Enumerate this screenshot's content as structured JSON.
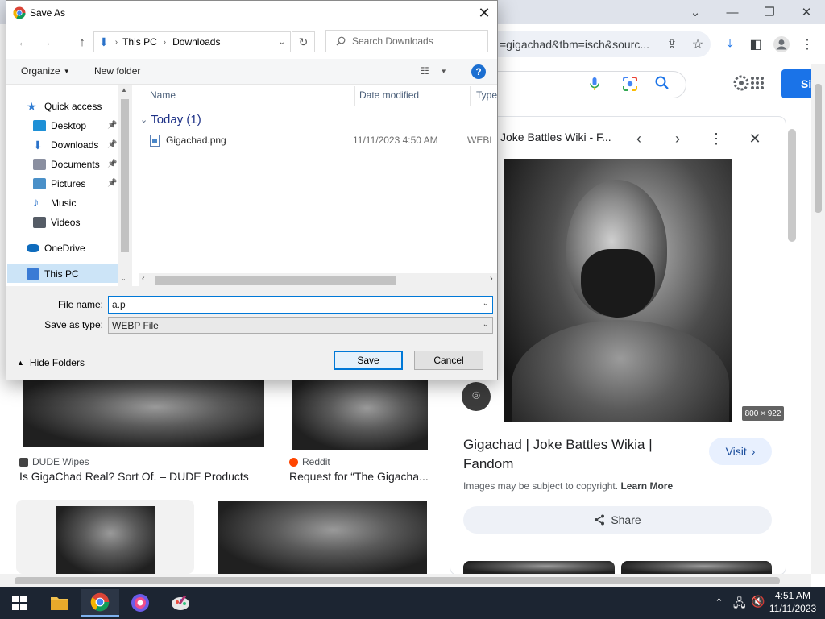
{
  "chrome": {
    "omnibox_text": "=gigachad&tbm=isch&sourc...",
    "window_controls": {
      "chevron_icon": "chevron-down-icon",
      "minimize_icon": "minimize-icon",
      "restore_icon": "restore-icon",
      "close_icon": "close-icon"
    }
  },
  "google": {
    "signin_label": "Si"
  },
  "results": [
    {
      "source": "DUDE Wipes",
      "title": "Is GigaChad Real? Sort Of. – DUDE Products",
      "favicon_color": "#444444"
    },
    {
      "source": "Reddit",
      "title": "Request for “The Gigacha...",
      "favicon_color": "#ff4500"
    }
  ],
  "side_panel": {
    "source": "Joke Battles Wiki - F...",
    "dimensions": "800 × 922",
    "title": "Gigachad | Joke Battles Wikia | Fandom",
    "visit_label": "Visit",
    "copyright_text": "Images may be subject to copyright.",
    "learn_more": "Learn More",
    "share_label": "Share"
  },
  "dialog": {
    "title": "Save As",
    "breadcrumb": [
      "This PC",
      "Downloads"
    ],
    "search_placeholder": "Search Downloads",
    "commands": {
      "organize": "Organize",
      "new_folder": "New folder"
    },
    "nav": [
      {
        "label": "Quick access",
        "icon": "star-icon",
        "color": "#2f7cd3"
      },
      {
        "label": "Desktop",
        "icon": "desktop-icon",
        "color": "#1e90d6",
        "pinned": true
      },
      {
        "label": "Downloads",
        "icon": "download-arrow-icon",
        "color": "#2a72c9",
        "pinned": true
      },
      {
        "label": "Documents",
        "icon": "document-icon",
        "color": "#8a8fa0",
        "pinned": true
      },
      {
        "label": "Pictures",
        "icon": "pictures-icon",
        "color": "#4a90c8",
        "pinned": true
      },
      {
        "label": "Music",
        "icon": "music-icon",
        "color": "#2a72c9"
      },
      {
        "label": "Videos",
        "icon": "videos-icon",
        "color": "#555c66"
      },
      {
        "label": "OneDrive",
        "icon": "cloud-icon",
        "color": "#0f6cbd"
      },
      {
        "label": "This PC",
        "icon": "computer-icon",
        "color": "#3a7bd5"
      }
    ],
    "columns": [
      "Name",
      "Date modified",
      "Type"
    ],
    "group": "Today (1)",
    "files": [
      {
        "name": "Gigachad.png",
        "date": "11/11/2023 4:50 AM",
        "type": "WEBP"
      }
    ],
    "file_name_label": "File name:",
    "file_name_value": "a.p",
    "save_type_label": "Save as type:",
    "save_type_value": "WEBP File",
    "hide_folders": "Hide Folders",
    "save_label": "Save",
    "cancel_label": "Cancel"
  },
  "taskbar": {
    "time": "4:51 AM",
    "date": "11/11/2023"
  },
  "colors": {
    "accent": "#0078d7",
    "google_blue": "#1a73e8",
    "taskbar": "#1c2532"
  }
}
